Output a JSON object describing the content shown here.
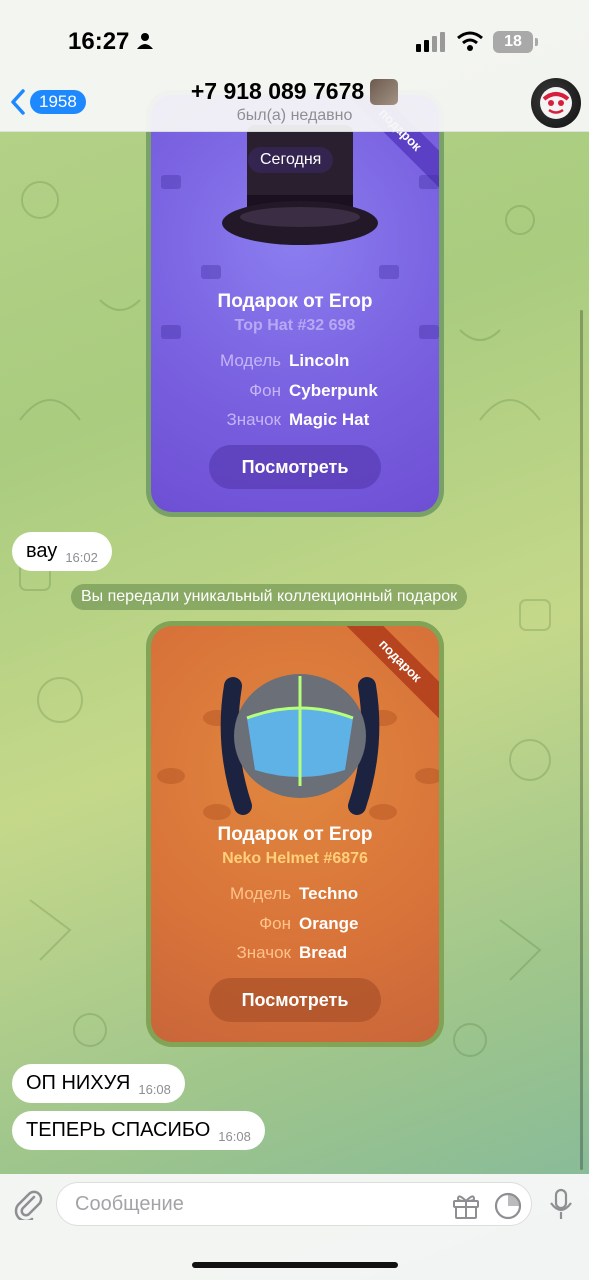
{
  "status": {
    "time": "16:27",
    "battery": "18"
  },
  "header": {
    "back_count": "1958",
    "title": "+7 918 089 7678",
    "subtitle": "был(а) недавно"
  },
  "gift1": {
    "date": "Сегодня",
    "ribbon": "подарок",
    "title": "Подарок от Егор",
    "subtitle": "Top Hat #32 698",
    "attrs": [
      {
        "label": "Модель",
        "value": "Lincoln"
      },
      {
        "label": "Фон",
        "value": "Cyberpunk"
      },
      {
        "label": "Значок",
        "value": "Magic Hat"
      }
    ],
    "button": "Посмотреть",
    "accent": "#7a62e0"
  },
  "messages": [
    {
      "text": "вау",
      "time": "16:02"
    },
    {
      "text": "ОП НИХУЯ",
      "time": "16:08"
    },
    {
      "text": "ТЕПЕРЬ СПАСИБО",
      "time": "16:08"
    }
  ],
  "service": "Вы передали уникальный коллекционный подарок",
  "gift2": {
    "ribbon": "подарок",
    "title": "Подарок от Егор",
    "subtitle": "Neko Helmet #6876",
    "attrs": [
      {
        "label": "Модель",
        "value": "Techno"
      },
      {
        "label": "Фон",
        "value": "Orange"
      },
      {
        "label": "Значок",
        "value": "Bread"
      }
    ],
    "button": "Посмотреть",
    "accent": "#d9743a"
  },
  "input": {
    "placeholder": "Сообщение"
  }
}
